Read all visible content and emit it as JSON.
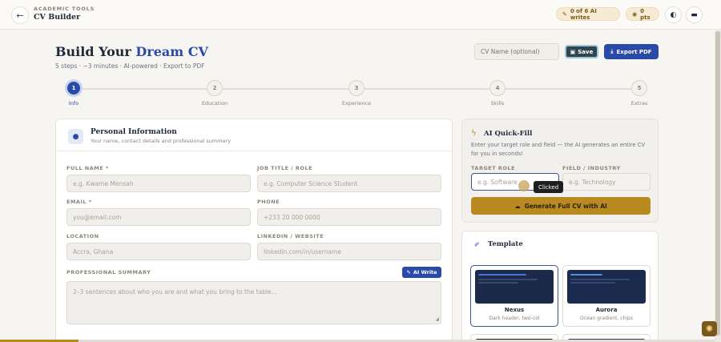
{
  "header": {
    "section_label": "ACADEMIC TOOLS",
    "title": "CV Builder",
    "ai_writes": "0 of 6 AI writes",
    "points": "0 pts"
  },
  "page": {
    "title_main": "Build Your ",
    "title_accent": "Dream CV",
    "meta": "5 steps · ~3 minutes · AI-powered · Export to PDF",
    "cv_name_placeholder": "CV Name (optional)",
    "save_label": "Save",
    "export_label": "Export PDF"
  },
  "steps": [
    {
      "number": "1",
      "label": "Info",
      "active": true
    },
    {
      "number": "2",
      "label": "Education",
      "active": false
    },
    {
      "number": "3",
      "label": "Experience",
      "active": false
    },
    {
      "number": "4",
      "label": "Skills",
      "active": false
    },
    {
      "number": "5",
      "label": "Extras",
      "active": false
    }
  ],
  "personal_info": {
    "title": "Personal Information",
    "subtitle": "Your name, contact details and professional summary",
    "full_name_label": "FULL NAME *",
    "full_name_placeholder": "e.g. Kwame Mensah",
    "job_title_label": "JOB TITLE / ROLE",
    "job_title_placeholder": "e.g. Computer Science Student",
    "email_label": "EMAIL *",
    "email_placeholder": "you@email.com",
    "phone_label": "PHONE",
    "phone_placeholder": "+233 20 000 0000",
    "location_label": "LOCATION",
    "location_value": "Accra, Ghana",
    "linkedin_label": "LINKEDIN / WEBSITE",
    "linkedin_placeholder": "linkedin.com/in/username",
    "summary_label": "PROFESSIONAL SUMMARY",
    "ai_write_label": "AI Write",
    "summary_placeholder": "2–3 sentences about who you are and what you bring to the table..."
  },
  "quick_fill": {
    "title": "AI Quick-Fill",
    "description": "Enter your target role and field — the AI generates an entire CV for you in seconds!",
    "role_label": "TARGET ROLE",
    "role_placeholder": "e.g. Software",
    "field_label": "FIELD / INDUSTRY",
    "field_placeholder": "e.g. Technology",
    "generate_label": "Generate Full CV with AI",
    "clicked_tooltip": "Clicked"
  },
  "template": {
    "title": "Template",
    "options": [
      {
        "name": "Nexus",
        "description": "Dark header, two-col",
        "selected": true
      },
      {
        "name": "Aurora",
        "description": "Ocean gradient, chips",
        "selected": false
      }
    ]
  },
  "colors": {
    "primary": "#2a4aa8",
    "gold": "#b98a1f",
    "thumb_dark": "#1c2a4a"
  },
  "progress": 0.11
}
